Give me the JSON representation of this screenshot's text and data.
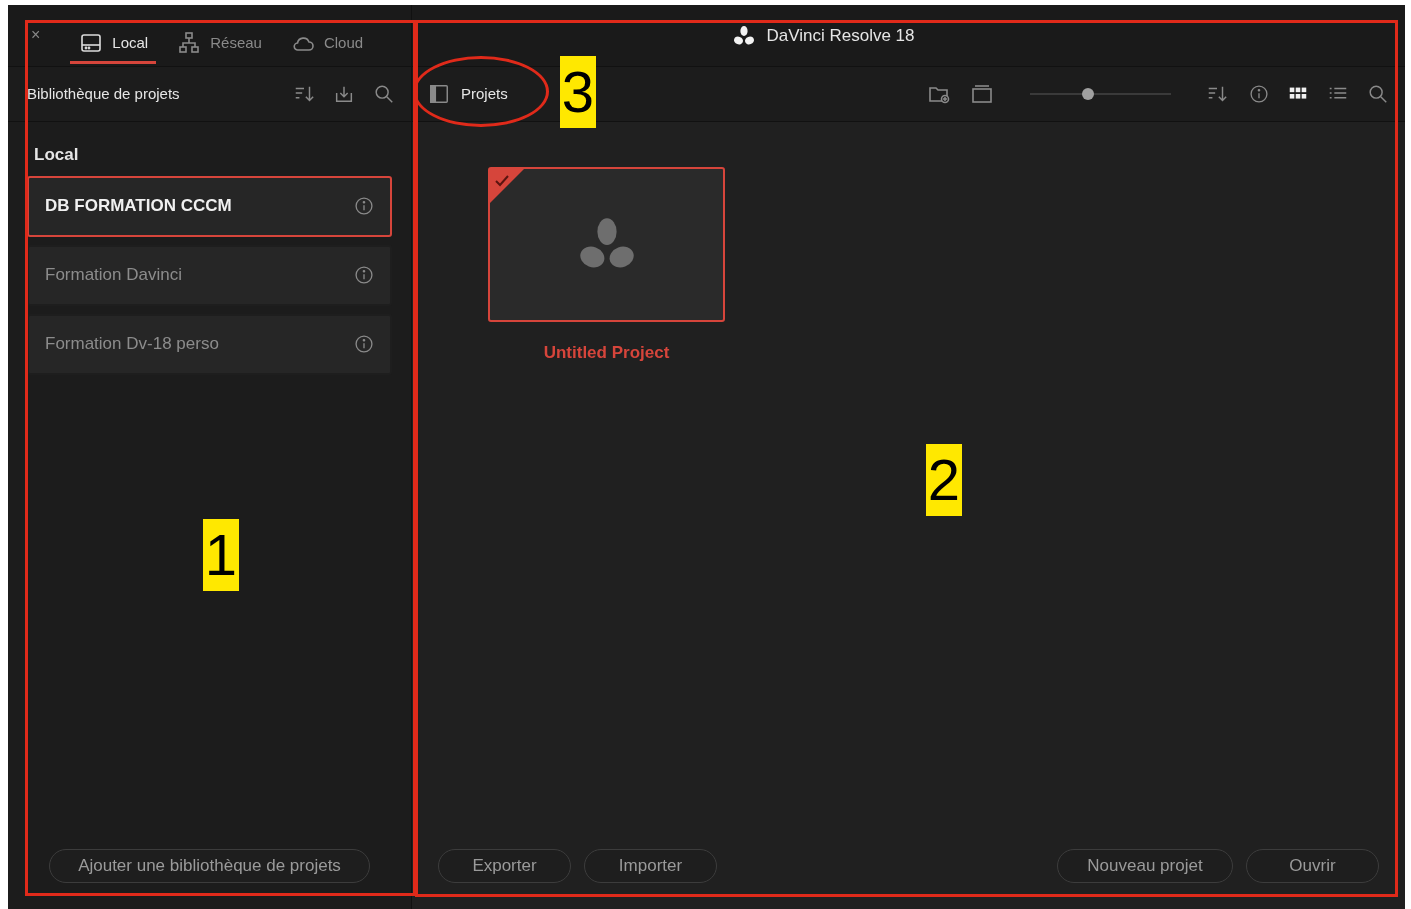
{
  "window": {
    "title": "DaVinci Resolve 18",
    "close_glyph": "×"
  },
  "tabs": [
    {
      "label": "Local",
      "selected": true
    },
    {
      "label": "Réseau",
      "selected": false
    },
    {
      "label": "Cloud",
      "selected": false
    }
  ],
  "library": {
    "title": "Bibliothèque de projets",
    "section": "Local",
    "items": [
      {
        "name": "DB FORMATION CCCM",
        "selected": true
      },
      {
        "name": "Formation Davinci",
        "selected": false
      },
      {
        "name": "Formation Dv-18 perso",
        "selected": false
      }
    ],
    "add_button": "Ajouter une bibliothèque de projets"
  },
  "projects": {
    "title": "Projets",
    "thumbnail_size": {
      "level": 0.4
    },
    "view_modes": [
      {
        "kind": "grid",
        "selected": true
      },
      {
        "kind": "list",
        "selected": false
      }
    ],
    "items": [
      {
        "name": "Untitled Project",
        "selected": true
      }
    ],
    "buttons_left": [
      "Exporter",
      "Importer"
    ],
    "buttons_right": [
      "Nouveau projet",
      "Ouvrir"
    ]
  },
  "annotations": [
    {
      "label": "1"
    },
    {
      "label": "2"
    },
    {
      "label": "3"
    }
  ]
}
